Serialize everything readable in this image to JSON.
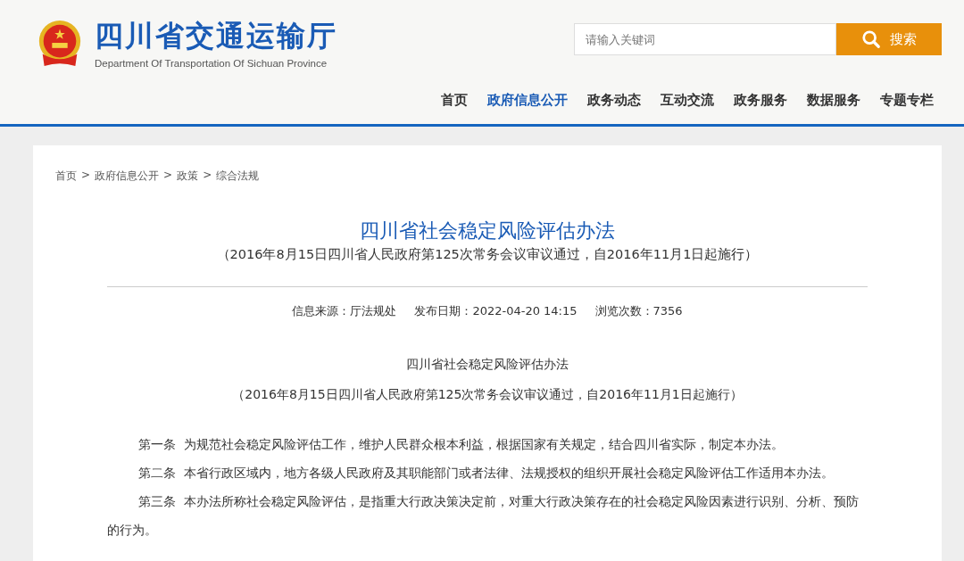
{
  "header": {
    "title": "四川省交通运输厅",
    "subtitle": "Department Of Transportation Of Sichuan Province"
  },
  "search": {
    "placeholder": "请输入关键词",
    "button": "搜索"
  },
  "nav": [
    {
      "label": "首页",
      "selected": false
    },
    {
      "label": "政府信息公开",
      "selected": true
    },
    {
      "label": "政务动态",
      "selected": false
    },
    {
      "label": "互动交流",
      "selected": false
    },
    {
      "label": "政务服务",
      "selected": false
    },
    {
      "label": "数据服务",
      "selected": false
    },
    {
      "label": "专题专栏",
      "selected": false
    }
  ],
  "breadcrumb": {
    "separator": ">",
    "items": [
      "首页",
      "政府信息公开",
      "政策",
      "综合法规"
    ]
  },
  "article": {
    "title": "四川省社会稳定风险评估办法",
    "subtitle": "（2016年8月15日四川省人民政府第125次常务会议审议通过，自2016年11月1日起施行）",
    "meta": [
      "信息来源：厅法规处",
      "发布日期：2022-04-20 14:15",
      "浏览次数：7356"
    ],
    "body_title": "四川省社会稳定风险评估办法",
    "body_subtitle": "（2016年8月15日四川省人民政府第125次常务会议审议通过，自2016年11月1日起施行）",
    "paragraphs": [
      "第一条  为规范社会稳定风险评估工作，维护人民群众根本利益，根据国家有关规定，结合四川省实际，制定本办法。",
      "第二条  本省行政区域内，地方各级人民政府及其职能部门或者法律、法规授权的组织开展社会稳定风险评估工作适用本办法。",
      "第三条  本办法所称社会稳定风险评估，是指重大行政决策决定前，对重大行政决策存在的社会稳定风险因素进行识别、分析、预防的行为。"
    ]
  }
}
